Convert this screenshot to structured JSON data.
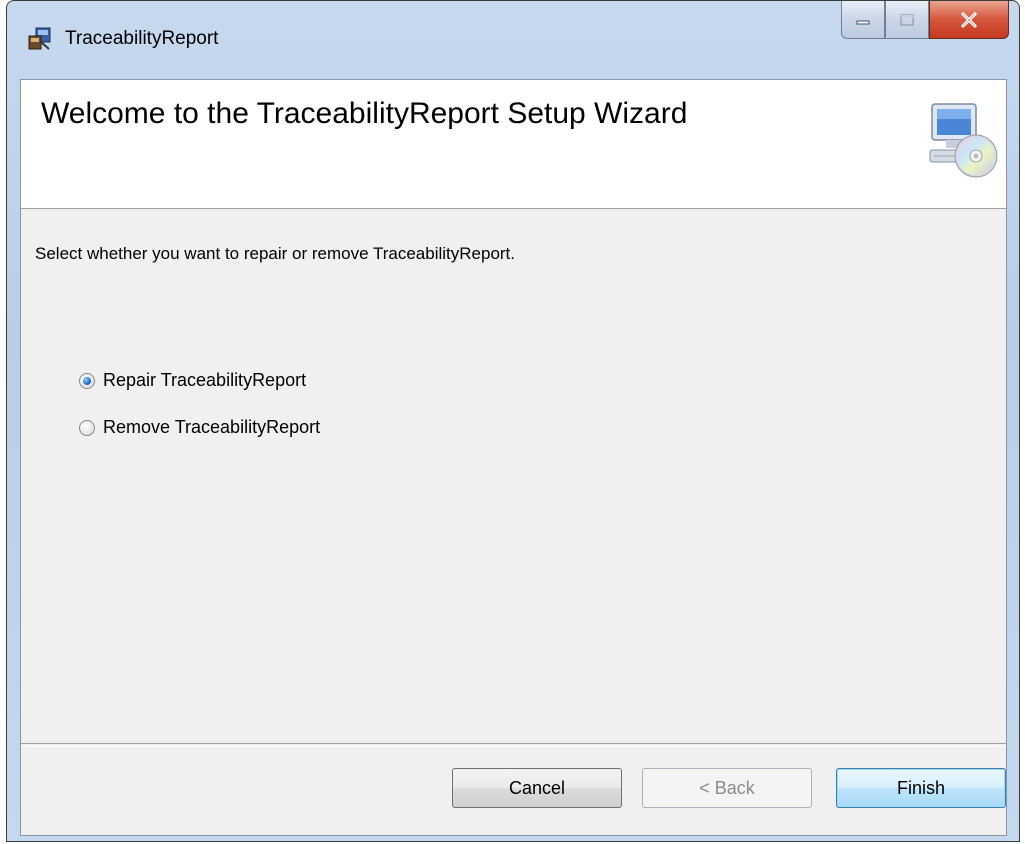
{
  "window": {
    "title": "TraceabilityReport",
    "icon": "installer-icon"
  },
  "caption_buttons": {
    "minimize": "minimize-icon",
    "maximize": "maximize-icon",
    "close": "close-icon"
  },
  "banner": {
    "title": "Welcome to the TraceabilityReport Setup Wizard",
    "icon": "computer-cd-icon"
  },
  "body": {
    "instruction": "Select whether you want to repair or remove TraceabilityReport.",
    "options": [
      {
        "label": "Repair TraceabilityReport",
        "selected": true
      },
      {
        "label": "Remove TraceabilityReport",
        "selected": false
      }
    ]
  },
  "buttons": {
    "cancel": "Cancel",
    "back": "< Back",
    "finish": "Finish",
    "back_enabled": false
  },
  "colors": {
    "title_bar": "#c5d8ee",
    "client_bg": "#f0f0f0",
    "banner_bg": "#ffffff",
    "close_button": "#c43a20",
    "default_button_border": "#3c7fb1"
  }
}
